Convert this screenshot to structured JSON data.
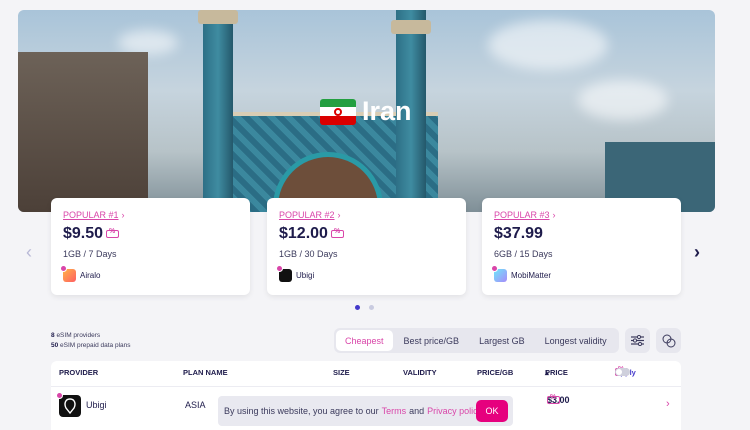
{
  "hero": {
    "country": "Iran",
    "flag_icon": "iran-flag-icon"
  },
  "popular_cards": [
    {
      "label": "POPULAR #1",
      "price": "$9.50",
      "plan": "1GB / 7 Days",
      "provider": "Airalo",
      "has_coupon": true
    },
    {
      "label": "POPULAR #2",
      "price": "$12.00",
      "plan": "1GB / 30 Days",
      "provider": "Ubigi",
      "has_coupon": true
    },
    {
      "label": "POPULAR #3",
      "price": "$37.99",
      "plan": "6GB / 15 Days",
      "provider": "MobiMatter",
      "has_coupon": false
    }
  ],
  "carousel": {
    "pages": 2,
    "active_page": 1
  },
  "stats": {
    "providers_count": "8",
    "providers_label": "eSIM providers",
    "plans_count": "50",
    "plans_label": "eSIM prepaid data plans"
  },
  "sort_tabs": [
    {
      "label": "Cheapest",
      "active": true
    },
    {
      "label": "Best price/GB",
      "active": false
    },
    {
      "label": "Largest GB",
      "active": false
    },
    {
      "label": "Longest validity",
      "active": false
    }
  ],
  "table": {
    "columns": {
      "provider": "PROVIDER",
      "plan_name": "PLAN NAME",
      "size": "SIZE",
      "validity": "VALIDITY",
      "price_gb": "PRICE/GB",
      "price": "PRICE",
      "apply": "Apply"
    },
    "rows": [
      {
        "provider": "Ubigi",
        "plan_name": "ASIA",
        "price": "$3.00"
      }
    ]
  },
  "cookie_banner": {
    "text_before": "By using this website, you agree to our",
    "terms": "Terms",
    "and": "and",
    "privacy": "Privacy policy",
    "ok": "OK"
  },
  "colors": {
    "accent": "#d946a9",
    "primary": "#1e1b4b",
    "ok_button": "#e6007e"
  }
}
